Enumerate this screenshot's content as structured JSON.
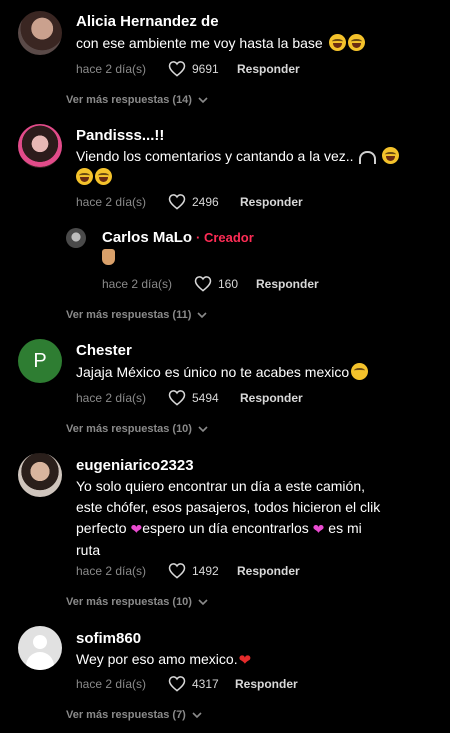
{
  "comments": [
    {
      "name": "Alicia Hernandez de",
      "text": "con ese ambiente me voy hasta la base",
      "date": "hace 2 día(s)",
      "likes": "9691",
      "reply_label": "Responder",
      "more_label": "Ver más respuestas (14)"
    },
    {
      "name": "Pandisss...!!",
      "text": "Viendo los comentarios y cantando a la vez..",
      "date": "hace 2 día(s)",
      "likes": "2496",
      "reply_label": "Responder",
      "reply": {
        "name": "Carlos MaLo",
        "badge": "· Creador",
        "date": "hace 2 día(s)",
        "likes": "160",
        "reply_label": "Responder"
      },
      "more_label": "Ver más respuestas (11)"
    },
    {
      "name": "Chester",
      "avatar_letter": "P",
      "text": "Jajaja México es único no te acabes mexico",
      "date": "hace 2 día(s)",
      "likes": "5494",
      "reply_label": "Responder",
      "more_label": "Ver más respuestas (10)"
    },
    {
      "name": "eugeniarico2323",
      "text_lines": [
        "Yo solo quiero encontrar un día a este camión,",
        "este chófer, esos pasajeros, todos hicieron el clik",
        "perfecto",
        "espero un día encontrarlos",
        "es mi",
        "ruta"
      ],
      "date": "hace 2 día(s)",
      "likes": "1492",
      "reply_label": "Responder",
      "more_label": "Ver más respuestas (10)"
    },
    {
      "name": "sofim860",
      "text": "Wey por eso amo mexico.",
      "date": "hace 2 día(s)",
      "likes": "4317",
      "reply_label": "Responder",
      "more_label": "Ver más respuestas (7)"
    }
  ],
  "colors": {
    "background": "#000000",
    "creator": "#fe2c55",
    "muted": "#8a8a8a",
    "avatar_green": "#2e7d32"
  },
  "icons": [
    "heart-outline-icon",
    "chevron-down-icon",
    "headphones-emoji-icon",
    "laughing-emoji-icon",
    "sweat-smile-emoji-icon",
    "pleading-emoji-icon",
    "horns-hand-emoji-icon",
    "red-heart-emoji-icon",
    "pink-hearts-emoji-icon",
    "default-avatar-icon"
  ]
}
